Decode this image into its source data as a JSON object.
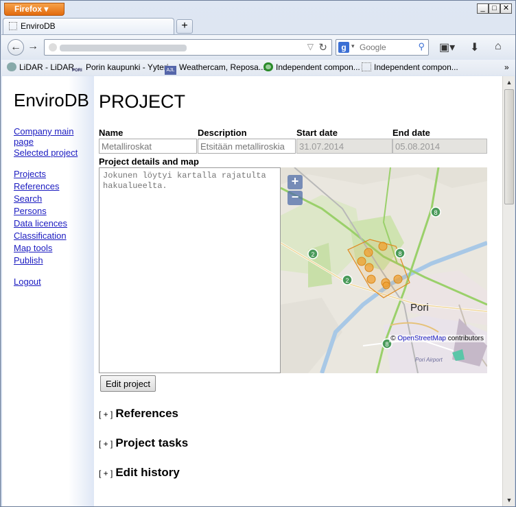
{
  "browser": {
    "app_button": "Firefox",
    "tab_title": "EnviroDB",
    "search_placeholder": "Google",
    "search_engine_letter": "g",
    "bookmarks": [
      "LiDAR - LiDAR",
      "Porin kaupunki - Yyteri",
      "Weathercam, Reposa...",
      "Independent compon...",
      "Independent compon..."
    ],
    "bookmark_icon_text": [
      "",
      "PORI",
      "AJL",
      "",
      ""
    ]
  },
  "sidebar": {
    "brand": "EnviroDB",
    "links": [
      "Company main page",
      "Selected project",
      "Projects",
      "References",
      "Search",
      "Persons",
      "Data licences",
      "Classification",
      "Map tools",
      "Publish",
      "Logout"
    ]
  },
  "project": {
    "title": "PROJECT",
    "labels": {
      "name": "Name",
      "description": "Description",
      "start": "Start date",
      "end": "End date",
      "details": "Project details and map"
    },
    "name_placeholder": "Metalliroskat",
    "description_placeholder": "Etsitään metalliroskia",
    "start_value": "31.07.2014",
    "end_value": "05.08.2014",
    "details_text": "Jokunen löytyi kartalla rajatulta hakualueelta.",
    "edit_button": "Edit project"
  },
  "map": {
    "zoom_in": "+",
    "zoom_out": "−",
    "city_label": "Pori",
    "attribution_prefix": "©",
    "attribution_link": "OpenStreetMap",
    "attribution_suffix": "contributors",
    "airport_label": "Pori Airport",
    "road_markers": [
      "8",
      "2",
      "2",
      "8",
      "8"
    ],
    "marker_color": "#f0a030",
    "area_color": "#e08a20"
  },
  "sections": [
    {
      "toggle": "[ + ]",
      "title": "References"
    },
    {
      "toggle": "[ + ]",
      "title": "Project tasks"
    },
    {
      "toggle": "[ + ]",
      "title": "Edit history"
    }
  ]
}
